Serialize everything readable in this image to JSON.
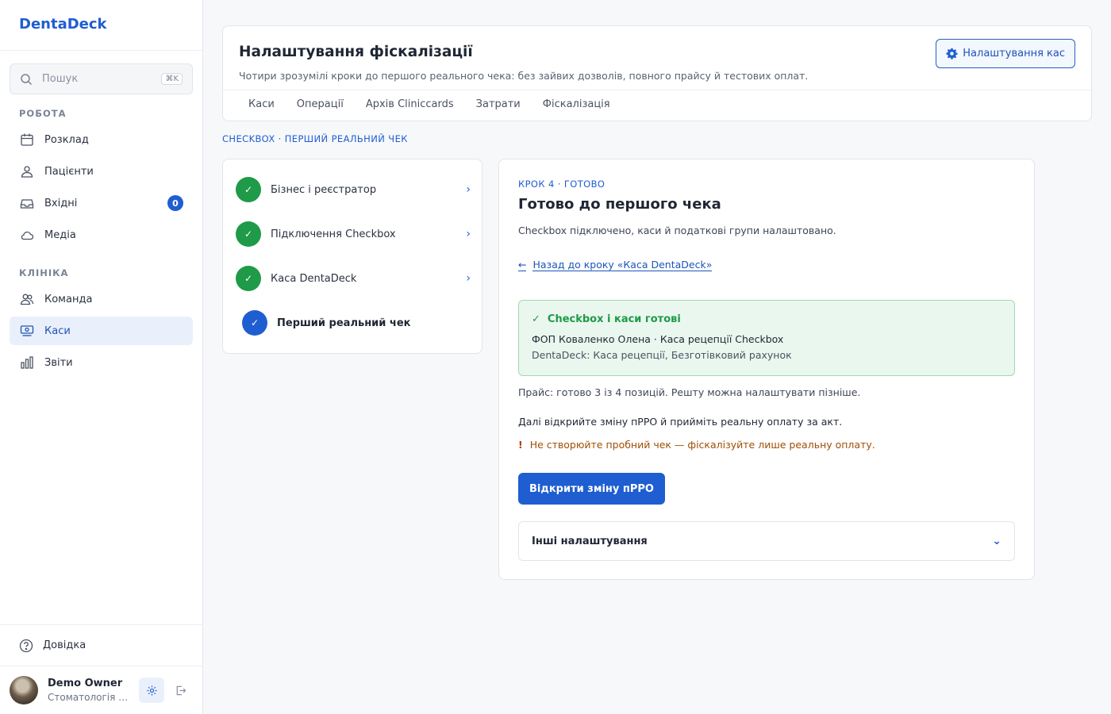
{
  "app": {
    "name": "DentaDeck"
  },
  "search": {
    "placeholder": "Пошук",
    "shortcut": "⌘K"
  },
  "sidebar": {
    "sections": [
      {
        "title": "РОБОТА"
      },
      {
        "title": "КЛІНІКА"
      }
    ],
    "items": [
      {
        "label": "Розклад",
        "icon": "calendar-icon"
      },
      {
        "label": "Пацієнти",
        "icon": "users-icon"
      },
      {
        "label": "Вхідні",
        "icon": "inbox-icon",
        "badge": "0"
      },
      {
        "label": "Медіа",
        "icon": "cloud-icon"
      },
      {
        "label": "Команда",
        "icon": "team-icon"
      },
      {
        "label": "Каси",
        "icon": "cash-register-icon",
        "active": true
      },
      {
        "label": "Звіти",
        "icon": "bar-chart-icon"
      }
    ],
    "help": "Довідка"
  },
  "user": {
    "name": "Demo Owner",
    "org": "Стоматологія П..."
  },
  "header": {
    "title": "Налаштування фіскалізації",
    "subtitle": "Чотири зрозумілі кроки до першого реального чека: без зайвих дозволів, повного прайсу й тестових оплат.",
    "settings_button": "Налаштування кас",
    "tabs": [
      "Каси",
      "Операції",
      "Архів Cliniccards",
      "Затрати",
      "Фіскалізація"
    ]
  },
  "breadcrumb": "CHECKBOX · ПЕРШИЙ РЕАЛЬНИЙ ЧЕК",
  "steps": [
    {
      "label": "Бізнес і реєстратор",
      "status": "done"
    },
    {
      "label": "Підключення Checkbox",
      "status": "done"
    },
    {
      "label": "Каса DentaDeck",
      "status": "done"
    },
    {
      "label": "Перший реальний чек",
      "status": "current"
    }
  ],
  "main": {
    "step_label": "КРОК 4 · ГОТОВО",
    "title": "Готово до першого чека",
    "description": "Checkbox підключено, каси й податкові групи налаштовано.",
    "back_link": "Назад до кроку «Каса DentaDeck»",
    "ok_box": {
      "title": "Checkbox і каси готові",
      "line1": "ФОП Коваленко Олена · Каса рецепції Checkbox",
      "line2": "DentaDeck: Каса рецепції, Безготівковий рахунок"
    },
    "price_note": "Прайс: готово 3 із 4 позицій. Решту можна налаштувати пізніше.",
    "next_note": "Далі відкрийте зміну пРРО й прийміть реальну оплату за акт.",
    "warning": "Не створюйте пробний чек — фіскалізуйте лише реальну оплату.",
    "primary_button": "Відкрити зміну пРРО",
    "accordion": "Інші налаштування"
  },
  "colors": {
    "accent": "#1f5ed1",
    "success": "#1e9a48",
    "warning": "#a04e05"
  }
}
